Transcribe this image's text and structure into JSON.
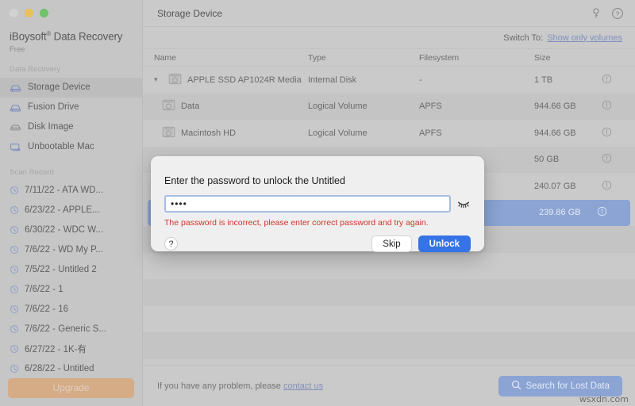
{
  "window": {
    "traffic_lights": [
      "close",
      "minimize",
      "maximize"
    ]
  },
  "sidebar": {
    "brand_title": "iBoysoft",
    "brand_title_sup": "®",
    "brand_title_rest": " Data Recovery",
    "brand_sub": "Free",
    "section_label": "Data Recovery",
    "nav_items": [
      {
        "label": "Storage Device",
        "icon": "hard-drive-icon",
        "active": true
      },
      {
        "label": "Fusion Drive",
        "icon": "fusion-drive-icon",
        "active": false
      },
      {
        "label": "Disk Image",
        "icon": "disk-image-icon",
        "active": false
      },
      {
        "label": "Unbootable Mac",
        "icon": "unbootable-mac-icon",
        "active": false
      }
    ],
    "scan_label": "Scan Record",
    "scan_records": [
      {
        "label": "7/11/22 - ATA WD..."
      },
      {
        "label": "6/23/22 - APPLE..."
      },
      {
        "label": "6/30/22 - WDC W..."
      },
      {
        "label": "7/6/22 - WD My P..."
      },
      {
        "label": "7/5/22 - Untitled 2"
      },
      {
        "label": "7/6/22 - 1"
      },
      {
        "label": "7/6/22 - 16"
      },
      {
        "label": "7/6/22 - Generic S..."
      },
      {
        "label": "6/27/22 - 1K-有"
      },
      {
        "label": "6/28/22 - Untitled"
      }
    ],
    "upgrade_label": "Upgrade"
  },
  "topbar": {
    "title": "Storage Device",
    "key_icon": "key-icon",
    "help_icon": "help-circle-icon"
  },
  "switchbar": {
    "label": "Switch To:",
    "link": "Show only volumes"
  },
  "table": {
    "columns": [
      "Name",
      "Type",
      "Filesystem",
      "Size"
    ],
    "rows": [
      {
        "name": "APPLE SSD AP1024R Media",
        "type": "Internal Disk",
        "filesystem": "-",
        "size": "1 TB",
        "level": 0,
        "expanded": true,
        "selected": false,
        "alt": false
      },
      {
        "name": "Data",
        "type": "Logical Volume",
        "filesystem": "APFS",
        "size": "944.66 GB",
        "level": 1,
        "expanded": false,
        "selected": false,
        "alt": true
      },
      {
        "name": "Macintosh HD",
        "type": "Logical Volume",
        "filesystem": "APFS",
        "size": "944.66 GB",
        "level": 1,
        "expanded": false,
        "selected": false,
        "alt": false
      },
      {
        "name": "",
        "type": "",
        "filesystem": "",
        "size": "50 GB",
        "level": 1,
        "expanded": false,
        "selected": false,
        "alt": true
      },
      {
        "name": "",
        "type": "",
        "filesystem": "",
        "size": "240.07 GB",
        "level": 1,
        "expanded": false,
        "selected": false,
        "alt": false
      },
      {
        "name": "",
        "type": "",
        "filesystem": "",
        "size": "239.86 GB",
        "level": 1,
        "expanded": false,
        "selected": true,
        "alt": false
      }
    ],
    "empty_row_count": 5
  },
  "bottombar": {
    "text_before": "If you have any problem, please",
    "link": "contact us",
    "search_button": "Search for Lost Data",
    "search_icon": "magnifier-icon"
  },
  "watermark": "wsxdn.com",
  "modal": {
    "title": "Enter the password to unlock the Untitled",
    "password_value": "••••",
    "password_placeholder": "",
    "eye_icon": "eye-closed-icon",
    "error": "The password is incorrect, please enter correct password and try again.",
    "help_label": "?",
    "skip_label": "Skip",
    "unlock_label": "Unlock"
  },
  "colors": {
    "accent_blue": "#3573e6",
    "selection_blue": "#8ba4d4",
    "error_red": "#d0342c",
    "upgrade_tan": "#d5ac86",
    "link_blue": "#7f8fc0"
  }
}
